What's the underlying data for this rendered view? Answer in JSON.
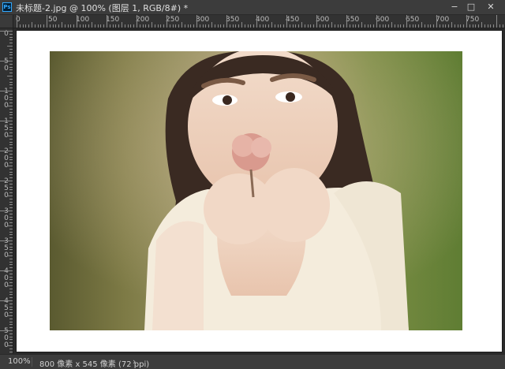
{
  "window": {
    "app_icon": "photoshop-icon",
    "title": "未标题-2.jpg @ 100% (图层 1, RGB/8#) *",
    "minimize_symbol": "−",
    "maximize_symbol": "□",
    "close_symbol": "✕"
  },
  "rulers": {
    "top_labels": [
      "0",
      "50",
      "100",
      "150",
      "200",
      "250",
      "300",
      "350",
      "400",
      "450",
      "500",
      "550",
      "600",
      "650",
      "700",
      "750"
    ],
    "left_labels": [
      "0",
      "5",
      "0",
      "1",
      "0",
      "0",
      "1",
      "5",
      "0",
      "2",
      "0",
      "0",
      "2",
      "5",
      "0",
      "3",
      "0",
      "0",
      "3",
      "5",
      "0",
      "4",
      "0",
      "0",
      "4",
      "5",
      "0",
      "5",
      "0",
      "0"
    ]
  },
  "status": {
    "zoom": "100%",
    "doc_info": "800 像素 x 545 像素 (72 ppi)",
    "arrow": "›"
  },
  "colors": {
    "ui_dark": "#282828",
    "ui_panel": "#3c3c3c",
    "ruler": "#323232",
    "document_border": "#ffffff",
    "ps_blue": "#31a8ff"
  }
}
